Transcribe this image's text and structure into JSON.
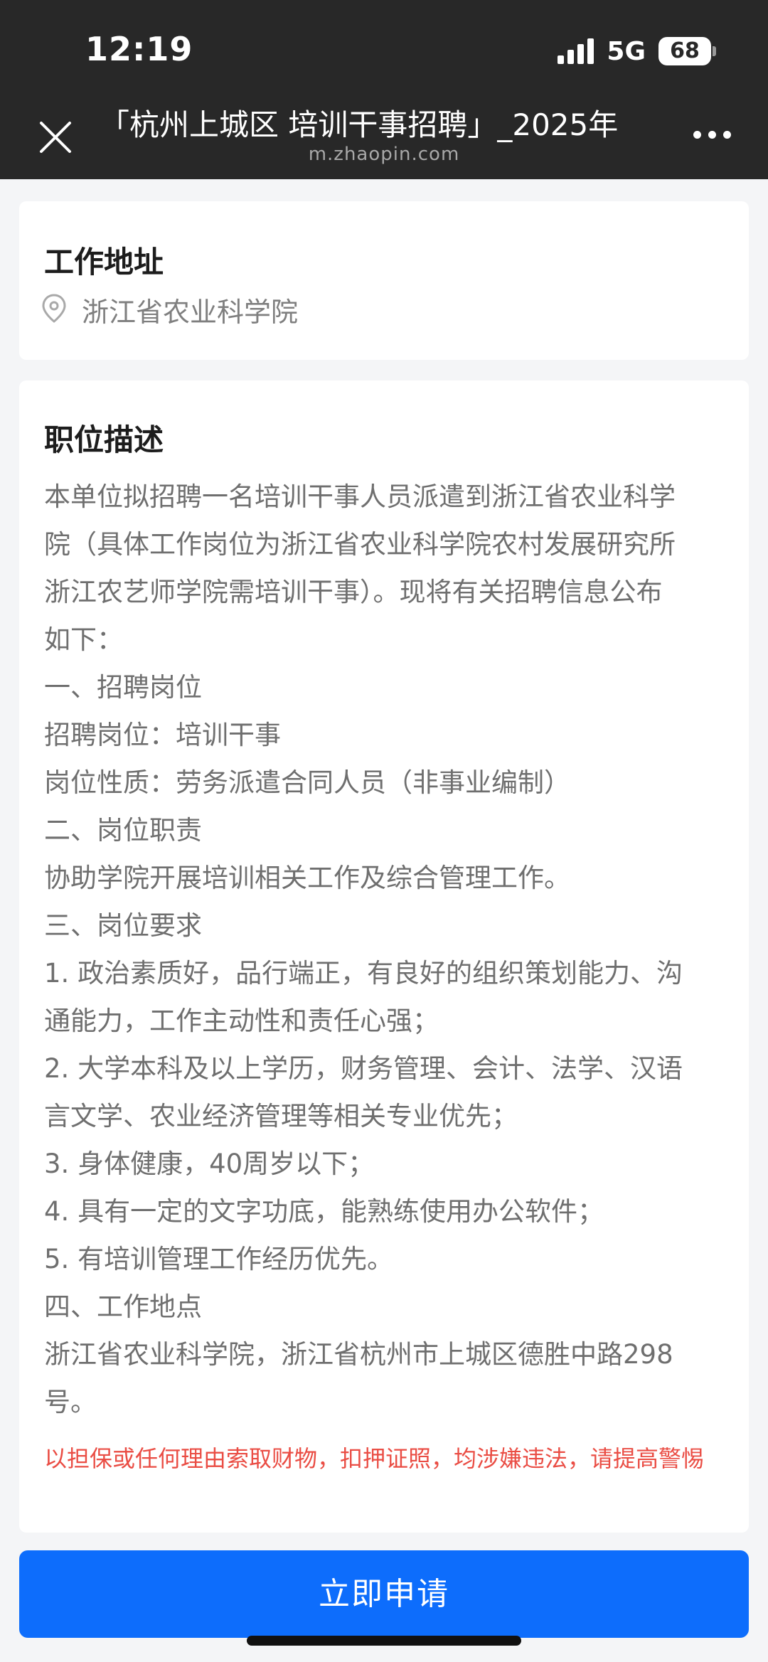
{
  "status_bar": {
    "time": "12:19",
    "network": "5G",
    "battery": "68"
  },
  "nav": {
    "close_icon": "close-icon",
    "title": "「杭州上城区 培训干事招聘」_2025年",
    "domain": "m.zhaopin.com",
    "more_icon": "more-icon"
  },
  "work_address": {
    "title": "工作地址",
    "icon": "location-pin-icon",
    "address": "浙江省农业科学院"
  },
  "job_description": {
    "title": "职位描述",
    "lines": [
      "本单位拟招聘一名培训干事人员派遣到浙江省农业科学",
      "院（具体工作岗位为浙江省农业科学院农村发展研究所",
      "浙江农艺师学院需培训干事）。现将有关招聘信息公布",
      "如下：",
      "一、招聘岗位",
      "招聘岗位：培训干事",
      "岗位性质：劳务派遣合同人员（非事业编制）",
      "二、岗位职责",
      "协助学院开展培训相关工作及综合管理工作。",
      "三、岗位要求",
      "1. 政治素质好，品行端正，有良好的组织策划能力、沟",
      "通能力，工作主动性和责任心强；",
      "2. 大学本科及以上学历，财务管理、会计、法学、汉语",
      "言文学、农业经济管理等相关专业优先；",
      "3. 身体健康，40周岁以下；",
      "4. 具有一定的文字功底，能熟练使用办公软件；",
      "5. 有培训管理工作经历优先。",
      "四、工作地点",
      "浙江省农业科学院，浙江省杭州市上城区德胜中路298",
      "号。"
    ],
    "warning": "以担保或任何理由索取财物，扣押证照，均涉嫌违法，请提高警惕"
  },
  "apply_button": {
    "label": "立即申请"
  },
  "colors": {
    "topbar": "#282828",
    "accent": "#0d6dfc",
    "warning": "#ea4d44",
    "body_text": "#6f6f6f"
  }
}
